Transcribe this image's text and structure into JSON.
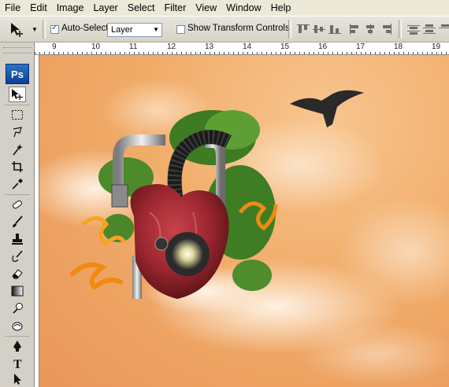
{
  "menubar": {
    "items": [
      "File",
      "Edit",
      "Image",
      "Layer",
      "Select",
      "Filter",
      "View",
      "Window",
      "Help"
    ]
  },
  "options": {
    "auto_select_label": "Auto-Select:",
    "auto_select_checked": true,
    "auto_select_value": "Layer",
    "transform_label": "Show Transform Controls",
    "transform_checked": false
  },
  "toolbox": {
    "logo": "Ps",
    "tools": [
      "move-icon",
      "marquee-icon",
      "lasso-icon",
      "magic-wand-icon",
      "crop-icon",
      "eyedropper-icon",
      "healing-brush-icon",
      "brush-icon",
      "clone-stamp-icon",
      "history-brush-icon",
      "eraser-icon",
      "gradient-icon",
      "dodge-icon",
      "burn-icon",
      "pen-icon",
      "type-icon",
      "path-select-icon"
    ]
  },
  "ruler": {
    "labels": [
      "9",
      "10",
      "11",
      "12",
      "13",
      "14",
      "15",
      "16",
      "17",
      "18",
      "19"
    ]
  },
  "colors": {
    "canvas_bg": "#f1ac69",
    "menubar_bg": "#ece9d8",
    "ps_blue": "#1f5fb6"
  }
}
